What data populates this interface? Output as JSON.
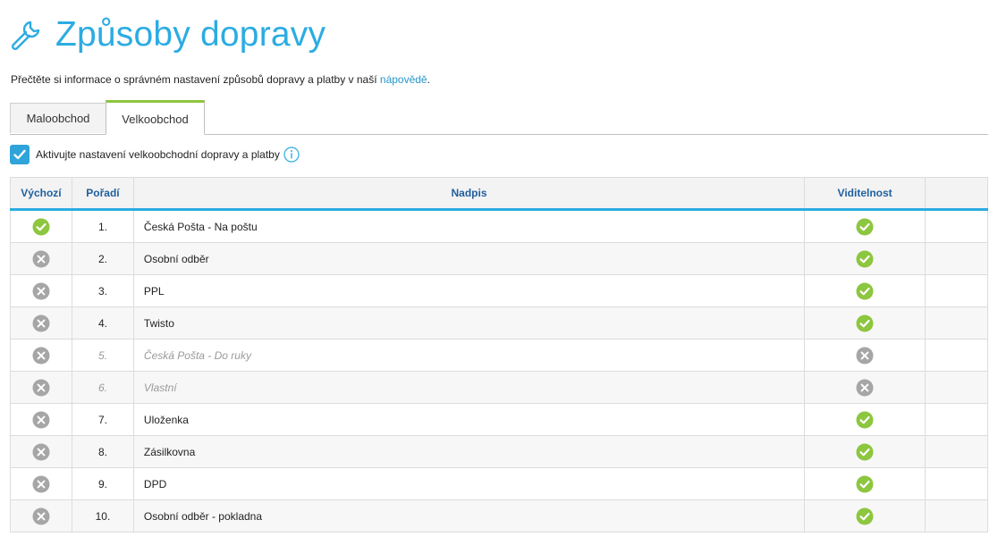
{
  "page": {
    "title": "Způsoby dopravy",
    "intro_text": "Přečtěte si informace o správném nastavení způsobů dopravy a platby v naší ",
    "intro_link": "nápovědě",
    "intro_end": "."
  },
  "tabs": [
    {
      "label": "Maloobchod",
      "active": false
    },
    {
      "label": "Velkoobchod",
      "active": true
    }
  ],
  "activate": {
    "label": "Aktivujte nastavení velkoobchodní dopravy a platby",
    "checked": true
  },
  "table": {
    "headers": {
      "default": "Výchozí",
      "order": "Pořadí",
      "label": "Nadpis",
      "visibility": "Viditelnost",
      "actions": ""
    },
    "rows": [
      {
        "default": true,
        "order": "1.",
        "label": "Česká Pošta - Na poštu",
        "visible": true
      },
      {
        "default": false,
        "order": "2.",
        "label": "Osobní odběr",
        "visible": true
      },
      {
        "default": false,
        "order": "3.",
        "label": "PPL",
        "visible": true
      },
      {
        "default": false,
        "order": "4.",
        "label": "Twisto",
        "visible": true
      },
      {
        "default": false,
        "order": "5.",
        "label": "Česká Pošta - Do ruky",
        "visible": false
      },
      {
        "default": false,
        "order": "6.",
        "label": "Vlastní",
        "visible": false
      },
      {
        "default": false,
        "order": "7.",
        "label": "Uloženka",
        "visible": true
      },
      {
        "default": false,
        "order": "8.",
        "label": "Zásilkovna",
        "visible": true
      },
      {
        "default": false,
        "order": "9.",
        "label": "DPD",
        "visible": true
      },
      {
        "default": false,
        "order": "10.",
        "label": "Osobní odběr - pokladna",
        "visible": true
      }
    ]
  },
  "colors": {
    "accent": "#2bace2",
    "green": "#8dc63f",
    "gray": "#a6a6a6",
    "header_text": "#1f5f9e"
  }
}
